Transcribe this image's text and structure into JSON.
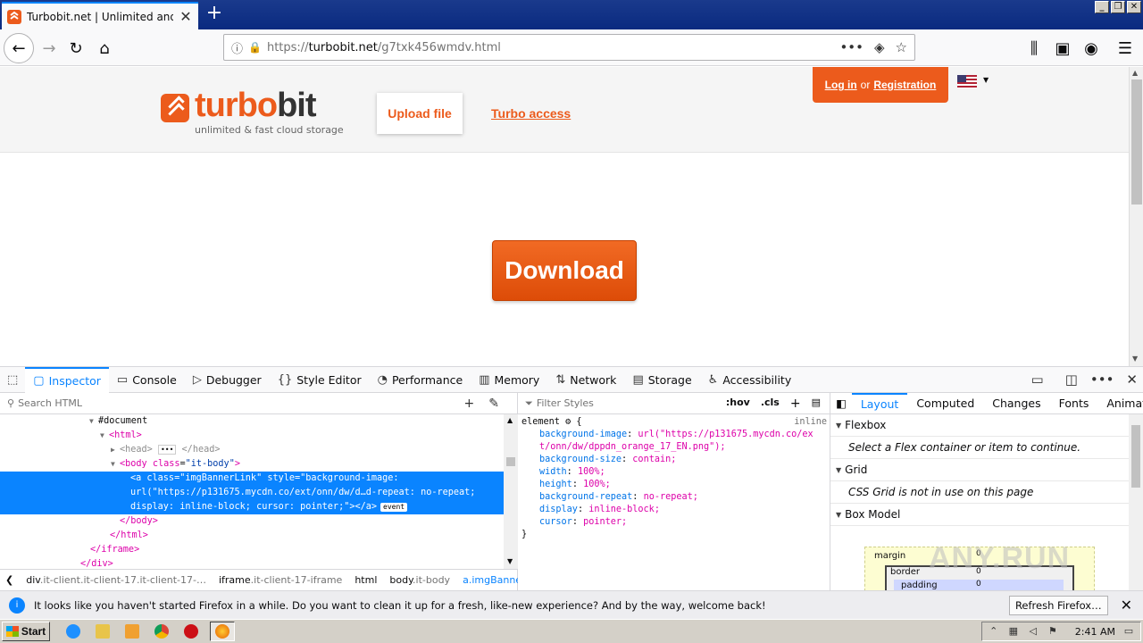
{
  "browser": {
    "tab_title": "Turbobit.net | Unlimited and fast file",
    "url_prefix": "https://",
    "url_host": "turbobit.net",
    "url_path": "/g7txk456wmdv.html"
  },
  "site": {
    "logo_text_a": "turbo",
    "logo_text_b": "bit",
    "tagline": "unlimited & fast cloud storage",
    "upload_label": "Upload file",
    "turbo_label": "Turbo access",
    "login_label": "Log in",
    "or_label": "or",
    "registration_label": "Registration",
    "download_label": "Download",
    "brand_color": "#ec5b1c"
  },
  "devtools": {
    "tabs": [
      {
        "label": "Inspector",
        "icon": "inspector-icon"
      },
      {
        "label": "Console",
        "icon": "console-icon"
      },
      {
        "label": "Debugger",
        "icon": "debugger-icon"
      },
      {
        "label": "Style Editor",
        "icon": "style-editor-icon"
      },
      {
        "label": "Performance",
        "icon": "performance-icon"
      },
      {
        "label": "Memory",
        "icon": "memory-icon"
      },
      {
        "label": "Network",
        "icon": "network-icon"
      },
      {
        "label": "Storage",
        "icon": "storage-icon"
      },
      {
        "label": "Accessibility",
        "icon": "accessibility-icon"
      }
    ],
    "search_placeholder": "Search HTML",
    "filter_placeholder": "Filter Styles",
    "hov": ":hov",
    "cls": ".cls",
    "tree": {
      "document": "#document",
      "html_open": "<html>",
      "head": "<head>",
      "head_close": "</head>",
      "body_tag": "<body",
      "body_attr": "class",
      "body_val": "\"it-body\"",
      "body_end": ">",
      "sel_line1": "<a class=\"imgBannerLink\" style=\"background-image:",
      "sel_line2": "url(\"https://p131675.mycdn.co/ext/onn/dw/d…d-repeat: no-repeat;",
      "sel_line3": "display: inline-block; cursor: pointer;\"></a>",
      "event_badge": "event",
      "body_close": "</body>",
      "html_close": "</html>",
      "iframe_close": "</iframe>",
      "div_close": "</div>"
    },
    "breadcrumbs": [
      {
        "a": "div",
        "b": ".it-client.it-client-17.it-client-17-…"
      },
      {
        "a": "iframe",
        "b": ".it-client-17-iframe"
      },
      {
        "a": "html",
        "b": ""
      },
      {
        "a": "body",
        "b": ".it-body"
      },
      {
        "a": "a",
        "b": ".imgBannerLink"
      }
    ],
    "rule": {
      "selector": "element",
      "brace_open": "{",
      "source": "inline",
      "props": [
        {
          "n": "background-image",
          "v": "url(\"https://p131675.mycdn.co/ext/onn/dw/dppdn_orange_17_EN.png\");"
        },
        {
          "n": "background-size",
          "v": "contain;"
        },
        {
          "n": "width",
          "v": "100%;"
        },
        {
          "n": "height",
          "v": "100%;"
        },
        {
          "n": "background-repeat",
          "v": "no-repeat;"
        },
        {
          "n": "display",
          "v": "inline-block;"
        },
        {
          "n": "cursor",
          "v": "pointer;"
        }
      ],
      "brace_close": "}"
    },
    "layout_tabs": [
      "Layout",
      "Computed",
      "Changes",
      "Fonts",
      "Animat"
    ],
    "flexbox_title": "Flexbox",
    "flexbox_desc": "Select a Flex container or item to continue.",
    "grid_title": "Grid",
    "grid_desc": "CSS Grid is not in use on this page",
    "boxmodel_title": "Box Model",
    "box": {
      "margin": "margin",
      "border": "border",
      "padding": "padding",
      "zero": "0"
    }
  },
  "notification": {
    "text": "It looks like you haven't started Firefox in a while. Do you want to clean it up for a fresh, like-new experience? And by the way, welcome back!",
    "button": "Refresh Firefox…"
  },
  "taskbar": {
    "start": "Start",
    "clock": "2:41 AM"
  },
  "watermark": "ANY.RUN"
}
